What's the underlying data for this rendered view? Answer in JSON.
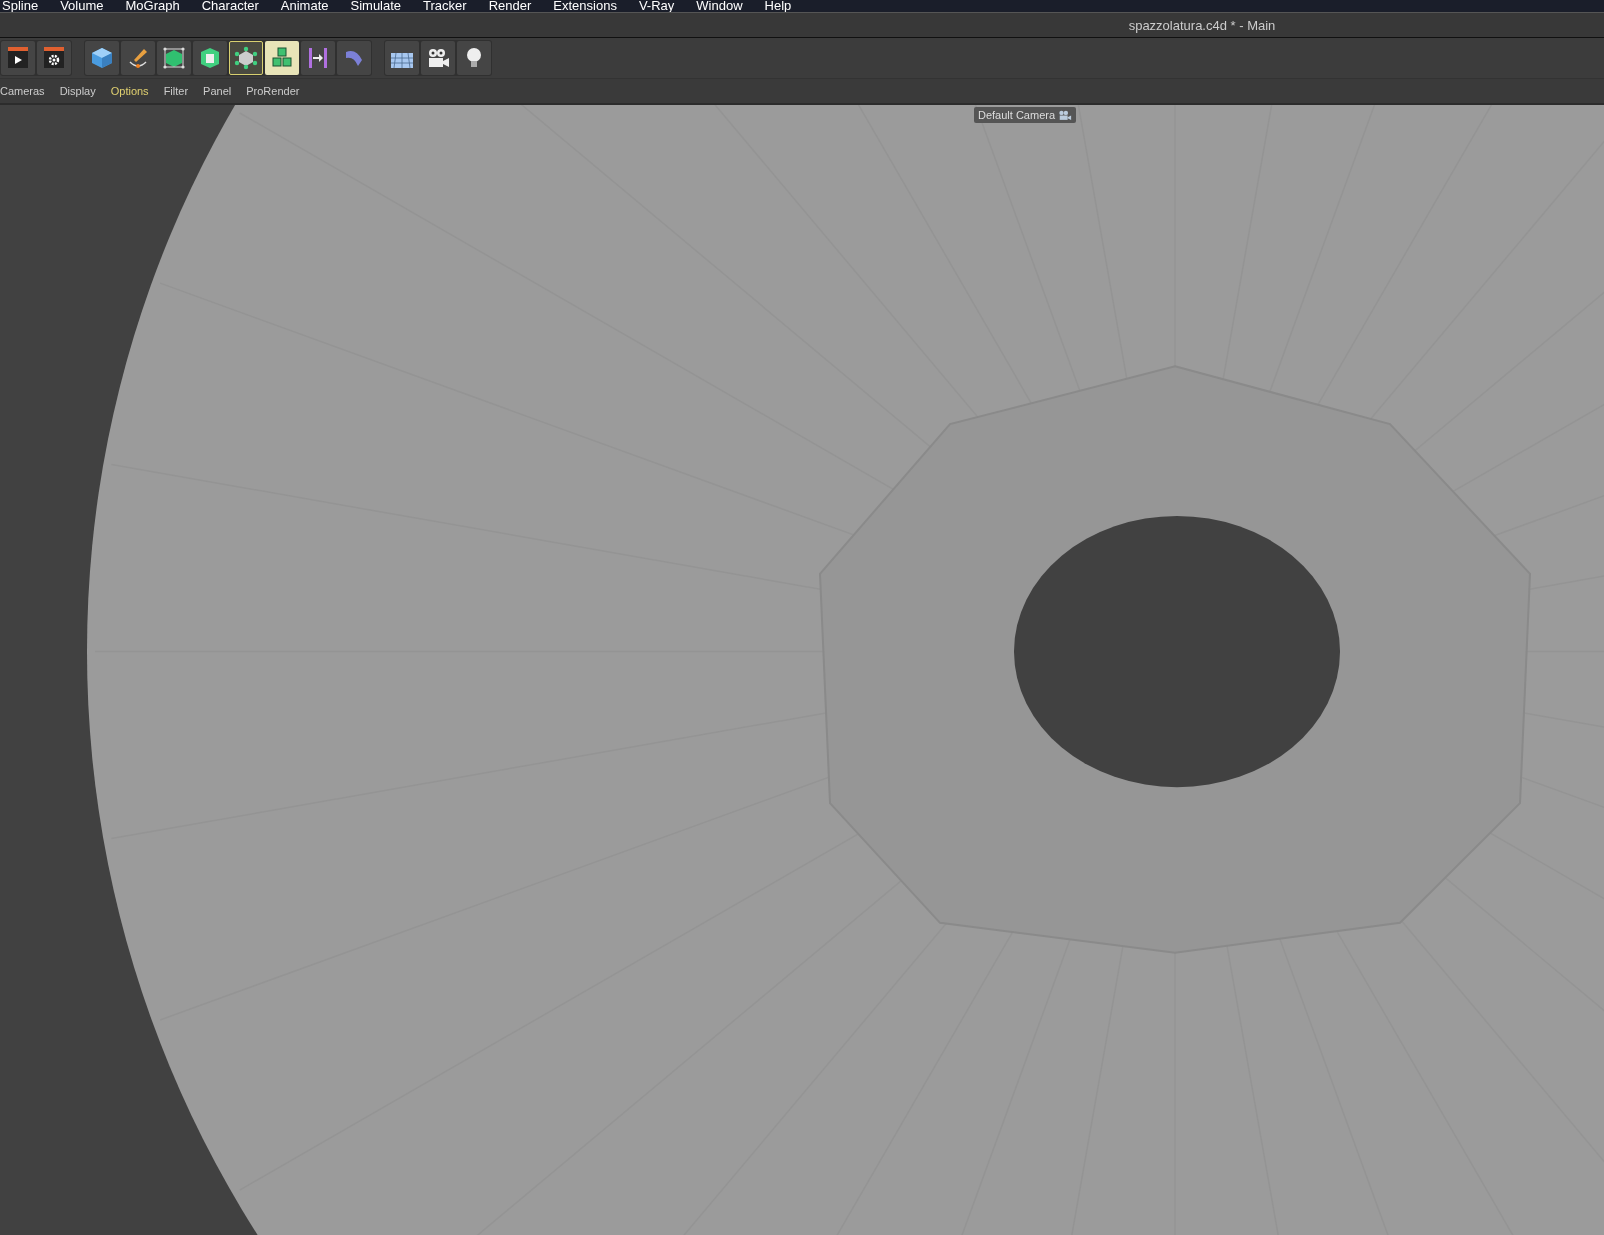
{
  "menu_bar": [
    "Spline",
    "Volume",
    "MoGraph",
    "Character",
    "Animate",
    "Simulate",
    "Tracker",
    "Render",
    "Extensions",
    "V-Ray",
    "Window",
    "Help"
  ],
  "window": {
    "title": "spazzolatura.c4d * - Main"
  },
  "toolbar": [
    {
      "kind": "render",
      "outlined": false,
      "selected": false
    },
    {
      "kind": "render-settings",
      "outlined": false,
      "selected": false
    },
    {
      "kind": "cube",
      "outlined": false,
      "selected": false
    },
    {
      "kind": "pen",
      "outlined": false,
      "selected": false
    },
    {
      "kind": "subdivision",
      "outlined": false,
      "selected": false
    },
    {
      "kind": "extrude",
      "outlined": false,
      "selected": false
    },
    {
      "kind": "array",
      "outlined": true,
      "selected": false
    },
    {
      "kind": "cloner",
      "outlined": false,
      "selected": true
    },
    {
      "kind": "symmetry",
      "outlined": false,
      "selected": false
    },
    {
      "kind": "bend",
      "outlined": false,
      "selected": false
    },
    {
      "kind": "floor",
      "outlined": false,
      "selected": false
    },
    {
      "kind": "camera",
      "outlined": false,
      "selected": false
    },
    {
      "kind": "light",
      "outlined": false,
      "selected": false
    }
  ],
  "view_menu": [
    {
      "label": "Cameras",
      "selected": false
    },
    {
      "label": "Display",
      "selected": false
    },
    {
      "label": "Options",
      "selected": true
    },
    {
      "label": "Filter",
      "selected": false
    },
    {
      "label": "Panel",
      "selected": false
    },
    {
      "label": "ProRender",
      "selected": false
    }
  ],
  "viewport": {
    "camera_label": "Default Camera"
  }
}
